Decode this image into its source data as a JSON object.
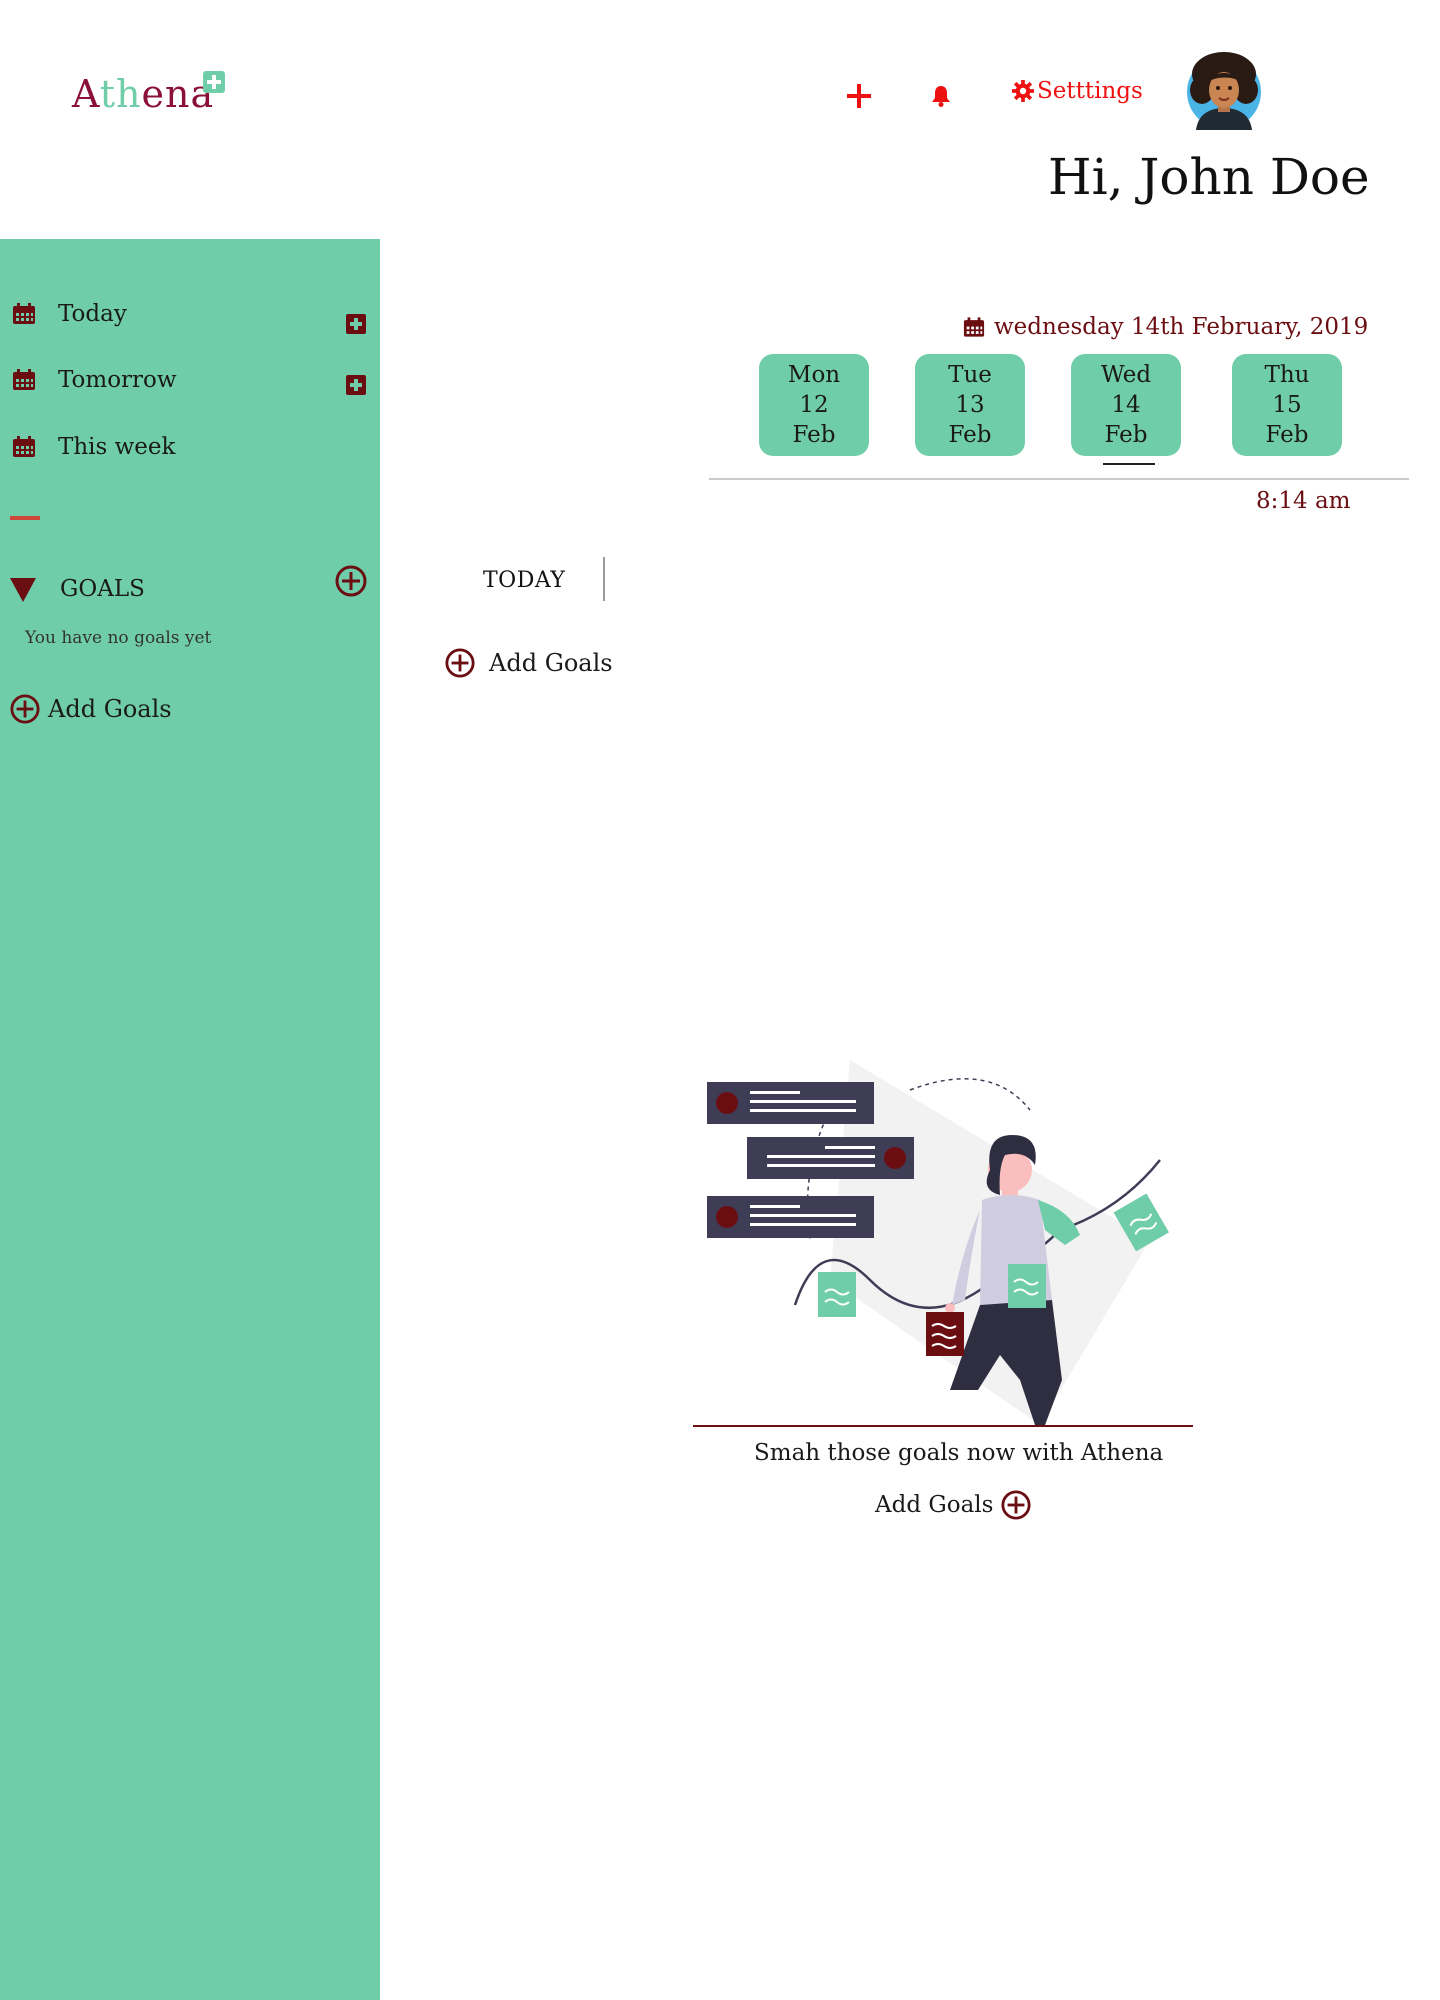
{
  "brand": {
    "part1": "A",
    "part2": "th",
    "part3": "e",
    "part4": "na"
  },
  "header": {
    "settings_label": "Setttings",
    "greeting": "Hi, John Doe"
  },
  "sidebar": {
    "items": [
      {
        "label": "Today"
      },
      {
        "label": "Tomorrow"
      },
      {
        "label": "This week"
      }
    ],
    "goals_title": "GOALS",
    "no_goals_text": "You have no goals yet",
    "add_goals_label": "Add Goals"
  },
  "date": {
    "full_date": "wednesday 14th February, 2019",
    "days": [
      {
        "name": "Mon",
        "num": "12",
        "month": "Feb"
      },
      {
        "name": "Tue",
        "num": "13",
        "month": "Feb"
      },
      {
        "name": "Wed",
        "num": "14",
        "month": "Feb"
      },
      {
        "name": "Thu",
        "num": "15",
        "month": "Feb"
      }
    ],
    "selected_day": "Wed",
    "time": "8:14 am"
  },
  "main": {
    "today_label": "TODAY",
    "add_goals_label": "Add Goals",
    "tagline": "Smah those goals now with Athena",
    "bottom_add_label": "Add Goals"
  },
  "colors": {
    "accent_green": "#6fcdaa",
    "maroon": "#6b0e12",
    "alert_red": "#ee1111",
    "brand_red": "#8a1038"
  },
  "icons": {
    "header": [
      "plus-icon",
      "bell-icon",
      "gear-icon"
    ],
    "sidebar": [
      "calendar-icon",
      "plus-square-icon",
      "triangle-down-icon",
      "plus-circle-icon"
    ]
  }
}
